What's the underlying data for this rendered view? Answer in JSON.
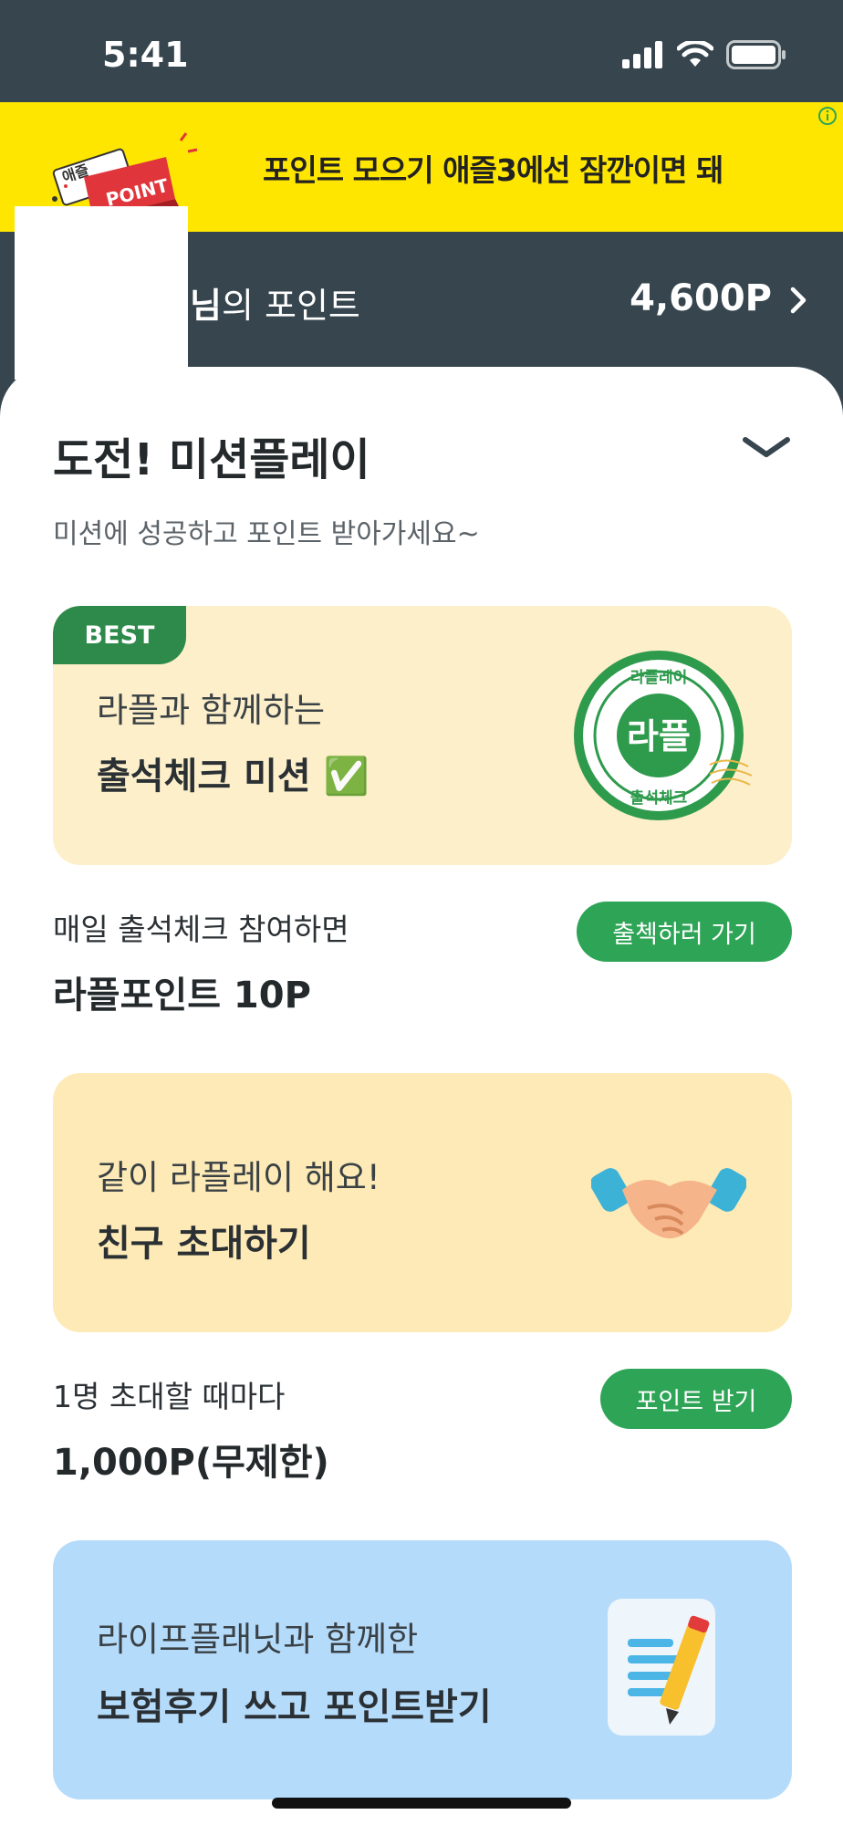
{
  "status": {
    "time": "5:41"
  },
  "ad": {
    "text": "포인트 모으기 애즐3에선 잠깐이면 돼",
    "graphic_label": "POINT",
    "graphic_brand": "애즐"
  },
  "header": {
    "user_suffix": "님",
    "point_label": "의 포인트",
    "point_value": "4,600P"
  },
  "mission": {
    "title": "도전! 미션플레이",
    "subtitle": "미션에 성공하고 포인트 받아가세요~",
    "cards": [
      {
        "badge": "BEST",
        "line1": "라플과 함께하는",
        "line2": "출석체크 미션 ✅",
        "stamp_top": "라플레이",
        "stamp_center": "라플",
        "stamp_bottom": "출석체크",
        "desc": "매일 출석체크 참여하면",
        "reward": "라플포인트 10P",
        "button": "출첵하러 가기",
        "bg": "#fdefca"
      },
      {
        "line1": "같이 라플레이 해요!",
        "line2": "친구 초대하기",
        "desc": "1명 초대할 때마다",
        "reward": "1,000P(무제한)",
        "button": "포인트 받기",
        "bg": "#feeab6"
      },
      {
        "line1": "라이프플래닛과 함께한",
        "line2": "보험후기 쓰고 포인트받기",
        "bg": "#b5dbfb"
      }
    ]
  },
  "colors": {
    "brand_green": "#2ea456",
    "header_bg": "#37464e",
    "ad_bg": "#ffe600"
  }
}
